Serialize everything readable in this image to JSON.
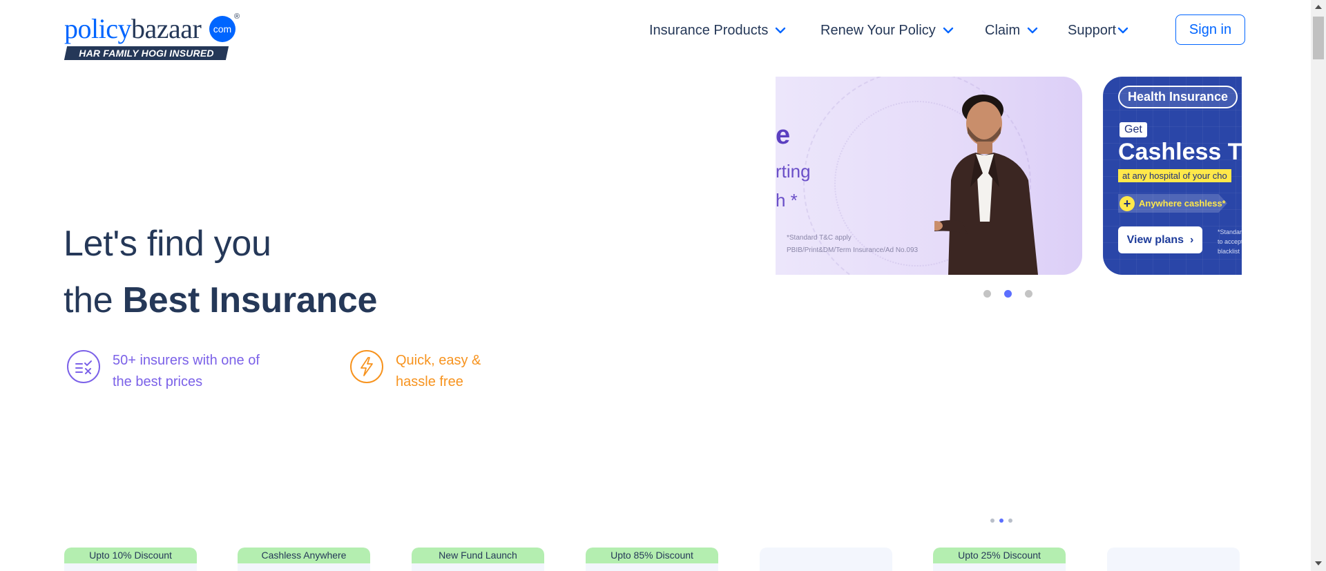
{
  "logo": {
    "word_part1": "policy",
    "word_part2": "bazaar",
    "com": "com",
    "registered": "®",
    "tagline": "HAR FAMILY HOGI INSURED",
    "colors": {
      "blue": "#0065ff",
      "navy": "#253858"
    }
  },
  "nav": {
    "items": [
      {
        "label": "Insurance Products",
        "icon": "chevron-down-icon"
      },
      {
        "label": "Renew Your Policy",
        "icon": "chevron-down-icon"
      },
      {
        "label": "Claim",
        "icon": "chevron-down-icon"
      },
      {
        "label": "Support",
        "icon": "chevron-down-icon"
      }
    ],
    "signin_label": "Sign in"
  },
  "hero": {
    "line1": "Let's find you",
    "line2_prefix": "the ",
    "line2_bold": "Best Insurance",
    "features": [
      {
        "text": "50+ insurers with one of the best prices",
        "icon": "compare-list-icon",
        "color": "#7b61e8"
      },
      {
        "text": "Quick, easy & hassle free",
        "icon": "lightning-icon",
        "color": "#f7931e"
      }
    ]
  },
  "carousel": {
    "banner1": {
      "partial_text_1": "e",
      "partial_text_2": "rting",
      "partial_text_3": "h *",
      "tc_line1": "*Standard T&C apply",
      "tc_line2": "PBIB/Print&DM/Term Insurance/Ad No.093"
    },
    "banner2": {
      "pill": "Health Insurance",
      "get": "Get",
      "headline": "Cashless T",
      "subline": "at any hospital of your cho",
      "anywhere": "Anywhere cashless*",
      "button": "View plans",
      "button_icon": "chevron-right-icon",
      "fine_line1": "*Standar",
      "fine_line2": "to accept",
      "fine_line3": "blacklist"
    },
    "dots_count": 3,
    "active_dot": 1
  },
  "product_cards": [
    {
      "badge": "Upto 10% Discount"
    },
    {
      "badge": "Cashless Anywhere"
    },
    {
      "badge": "New Fund Launch"
    },
    {
      "badge": "Upto 85% Discount"
    },
    {
      "badge": ""
    },
    {
      "badge": "Upto 25% Discount"
    },
    {
      "badge": ""
    }
  ],
  "products_pager": {
    "dots_count": 3,
    "active_dot": 1
  }
}
